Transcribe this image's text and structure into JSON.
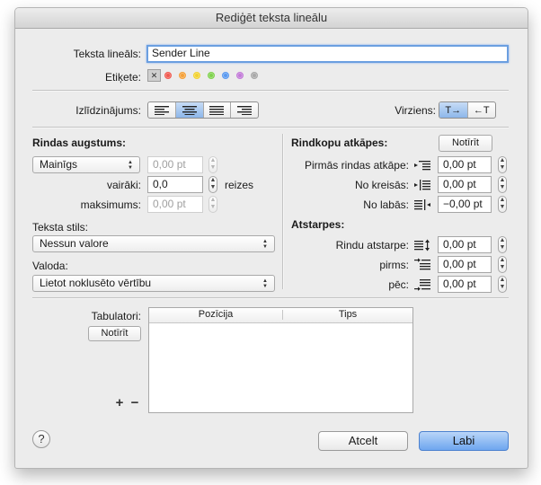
{
  "window": {
    "title": "Rediģēt teksta lineālu"
  },
  "ruler": {
    "label": "Teksta lineāls:",
    "value": "Sender Line"
  },
  "tag": {
    "label": "Etiķete:",
    "clear_glyph": "✕",
    "colors": [
      "#f05a50",
      "#f5a13a",
      "#f2d230",
      "#7fd24d",
      "#5a9af0",
      "#c27ad8",
      "#a8a8a8"
    ]
  },
  "alignment": {
    "label": "Izlīdzinājums:",
    "options": [
      "align-left",
      "align-center",
      "align-justify",
      "align-right"
    ],
    "selected": "align-center"
  },
  "direction": {
    "label": "Virziens:",
    "ltr": "T→",
    "rtl": "←T",
    "selected": "ltr"
  },
  "line_height": {
    "title": "Rindas augstums:",
    "mode": "Mainīgs",
    "value": "0,00 pt",
    "multiple_label": "vairāki:",
    "multiple_value": "0,0",
    "times_label": "reizes",
    "max_label": "maksimums:",
    "max_value": "0,00 pt"
  },
  "text_style": {
    "label": "Teksta stils:",
    "value": "Nessun valore"
  },
  "language": {
    "label": "Valoda:",
    "value": "Lietot noklusēto vērtību"
  },
  "indents": {
    "title": "Rindkopu atkāpes:",
    "reset": "Notīrīt",
    "first_line_label": "Pirmās rindas atkāpe:",
    "first_line_value": "0,00 pt",
    "left_label": "No kreisās:",
    "left_value": "0,00 pt",
    "right_label": "No labās:",
    "right_value": "−0,00 pt"
  },
  "spacing": {
    "title": "Atstarpes:",
    "line_label": "Rindu atstarpe:",
    "line_value": "0,00 pt",
    "before_label": "pirms:",
    "before_value": "0,00 pt",
    "after_label": "pēc:",
    "after_value": "0,00 pt"
  },
  "tabs": {
    "label": "Tabulatori:",
    "reset": "Notīrīt",
    "col_position": "Pozīcija",
    "col_type": "Tips",
    "add": "+",
    "remove": "−"
  },
  "footer": {
    "help": "?",
    "cancel": "Atcelt",
    "ok": "Labi"
  }
}
